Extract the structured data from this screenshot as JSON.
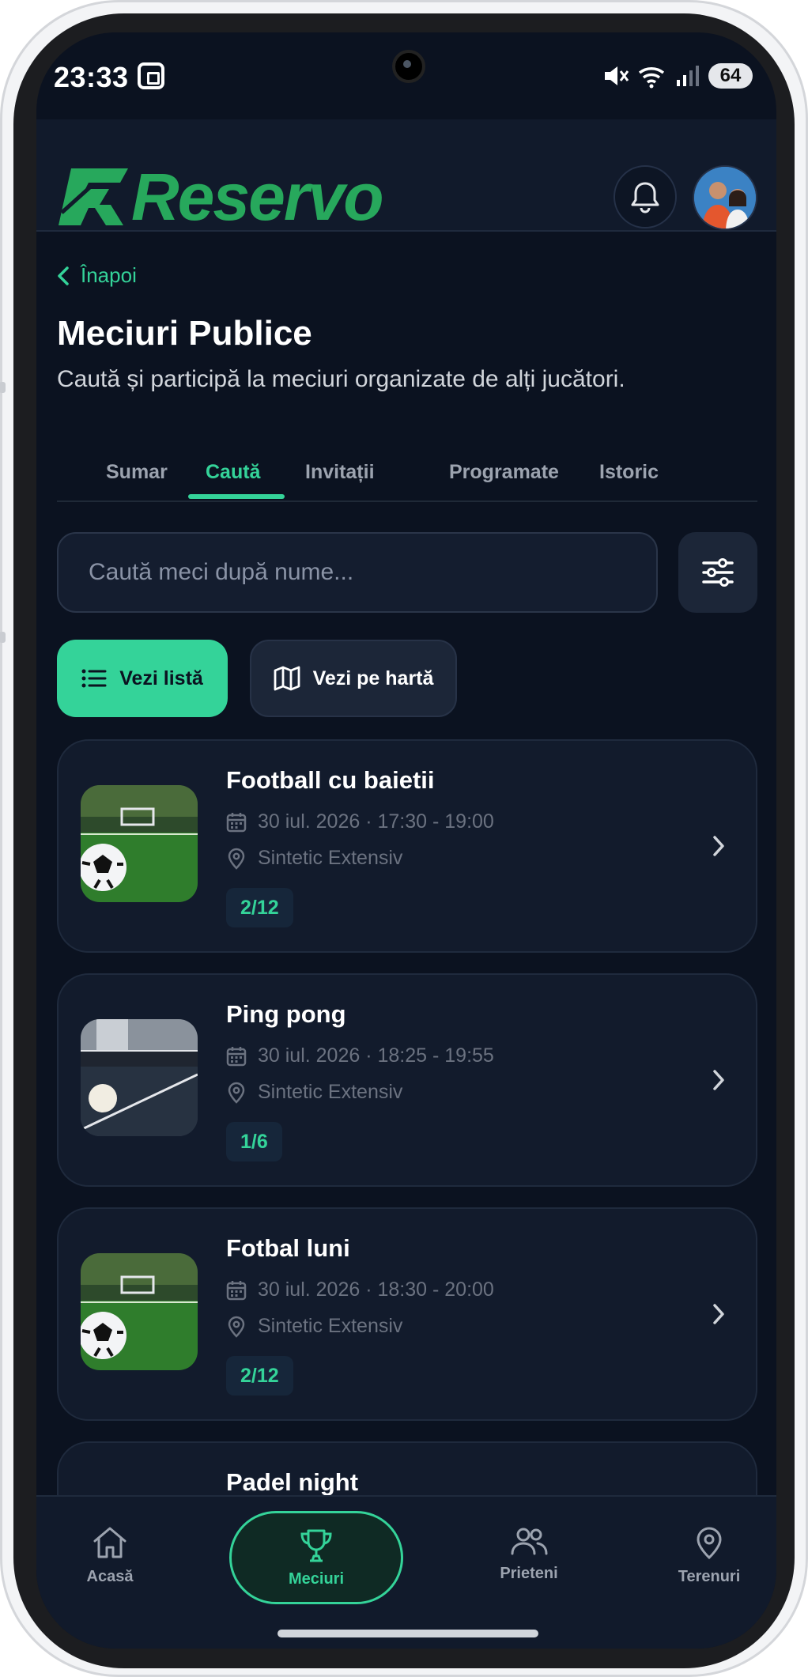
{
  "status_bar": {
    "time": "23:33",
    "battery": "64"
  },
  "header": {
    "logo_text": "Reservo"
  },
  "page": {
    "back_label": "Înapoi",
    "title": "Meciuri Publice",
    "subtitle": "Caută și participă la meciuri organizate de alți jucători."
  },
  "tabs": [
    {
      "label": "Sumar",
      "active": false
    },
    {
      "label": "Caută",
      "active": true
    },
    {
      "label": "Invitații",
      "active": false
    },
    {
      "label": "Programate",
      "active": false
    },
    {
      "label": "Istoric",
      "active": false
    }
  ],
  "search": {
    "placeholder": "Caută meci după nume..."
  },
  "view_toggle": {
    "list_label": "Vezi listă",
    "map_label": "Vezi pe hartă"
  },
  "matches": [
    {
      "title": "Football cu baietii",
      "datetime": "30 iul. 2026 · 17:30 - 19:00",
      "location": "Sintetic Extensiv",
      "players": "2/12",
      "image": "football-field"
    },
    {
      "title": "Ping pong",
      "datetime": "30 iul. 2026 · 18:25 - 19:55",
      "location": "Sintetic Extensiv",
      "players": "1/6",
      "image": "ping-pong-table"
    },
    {
      "title": "Fotbal luni",
      "datetime": "30 iul. 2026 · 18:30 - 20:00",
      "location": "Sintetic Extensiv",
      "players": "2/12",
      "image": "football-field"
    },
    {
      "title": "Padel night",
      "datetime": "",
      "location": "",
      "players": "",
      "image": ""
    }
  ],
  "bottom_nav": [
    {
      "label": "Acasă",
      "icon": "home-icon",
      "active": false
    },
    {
      "label": "Meciuri",
      "icon": "trophy-icon",
      "active": true
    },
    {
      "label": "Prieteni",
      "icon": "friends-icon",
      "active": false
    },
    {
      "label": "Terenuri",
      "icon": "map-pin-icon",
      "active": false
    }
  ],
  "colors": {
    "accent": "#34d399",
    "background": "#0b1220",
    "card": "#121b2c",
    "brand_green": "#27a85c"
  }
}
